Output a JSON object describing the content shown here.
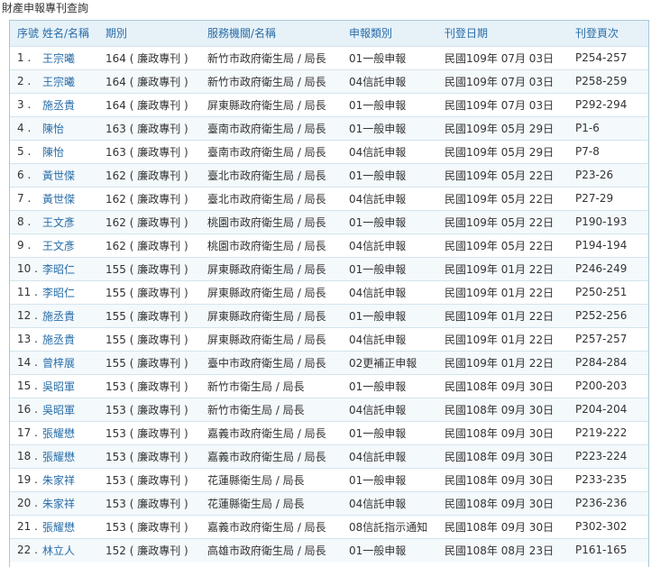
{
  "page": {
    "title": "財產申報專刊查詢"
  },
  "table": {
    "headers": {
      "no": "序號",
      "name": "姓名/名稱",
      "issue": "期別",
      "org": "服務機關/名稱",
      "type": "申報類別",
      "date": "刊登日期",
      "page": "刊登頁次"
    },
    "rows": [
      {
        "no": "1 .",
        "name": "王宗曦",
        "issue": "164 ( 廉政專刊 )",
        "org": "新竹市政府衛生局 / 局長",
        "type": "01一般申報",
        "date": "民國109年 07月 03日",
        "page": "P254-257"
      },
      {
        "no": "2 .",
        "name": "王宗曦",
        "issue": "164 ( 廉政專刊 )",
        "org": "新竹市政府衛生局 / 局長",
        "type": "04信託申報",
        "date": "民國109年 07月 03日",
        "page": "P258-259"
      },
      {
        "no": "3 .",
        "name": "施丞貴",
        "issue": "164 ( 廉政專刊 )",
        "org": "屏東縣政府衛生局 / 局長",
        "type": "01一般申報",
        "date": "民國109年 07月 03日",
        "page": "P292-294"
      },
      {
        "no": "4 .",
        "name": "陳怡",
        "issue": "163 ( 廉政專刊 )",
        "org": "臺南市政府衛生局 / 局長",
        "type": "01一般申報",
        "date": "民國109年 05月 29日",
        "page": "P1-6"
      },
      {
        "no": "5 .",
        "name": "陳怡",
        "issue": "163 ( 廉政專刊 )",
        "org": "臺南市政府衛生局 / 局長",
        "type": "04信託申報",
        "date": "民國109年 05月 29日",
        "page": "P7-8"
      },
      {
        "no": "6 .",
        "name": "黃世傑",
        "issue": "162 ( 廉政專刊 )",
        "org": "臺北市政府衛生局 / 局長",
        "type": "01一般申報",
        "date": "民國109年 05月 22日",
        "page": "P23-26"
      },
      {
        "no": "7 .",
        "name": "黃世傑",
        "issue": "162 ( 廉政專刊 )",
        "org": "臺北市政府衛生局 / 局長",
        "type": "04信託申報",
        "date": "民國109年 05月 22日",
        "page": "P27-29"
      },
      {
        "no": "8 .",
        "name": "王文彥",
        "issue": "162 ( 廉政專刊 )",
        "org": "桃園市政府衛生局 / 局長",
        "type": "01一般申報",
        "date": "民國109年 05月 22日",
        "page": "P190-193"
      },
      {
        "no": "9 .",
        "name": "王文彥",
        "issue": "162 ( 廉政專刊 )",
        "org": "桃園市政府衛生局 / 局長",
        "type": "04信託申報",
        "date": "民國109年 05月 22日",
        "page": "P194-194"
      },
      {
        "no": "10 .",
        "name": "李昭仁",
        "issue": "155 ( 廉政專刊 )",
        "org": "屏東縣政府衛生局 / 局長",
        "type": "01一般申報",
        "date": "民國109年 01月 22日",
        "page": "P246-249"
      },
      {
        "no": "11 .",
        "name": "李昭仁",
        "issue": "155 ( 廉政專刊 )",
        "org": "屏東縣政府衛生局 / 局長",
        "type": "04信託申報",
        "date": "民國109年 01月 22日",
        "page": "P250-251"
      },
      {
        "no": "12 .",
        "name": "施丞貴",
        "issue": "155 ( 廉政專刊 )",
        "org": "屏東縣政府衛生局 / 局長",
        "type": "01一般申報",
        "date": "民國109年 01月 22日",
        "page": "P252-256"
      },
      {
        "no": "13 .",
        "name": "施丞貴",
        "issue": "155 ( 廉政專刊 )",
        "org": "屏東縣政府衛生局 / 局長",
        "type": "04信託申報",
        "date": "民國109年 01月 22日",
        "page": "P257-257"
      },
      {
        "no": "14 .",
        "name": "曾梓展",
        "issue": "155 ( 廉政專刊 )",
        "org": "臺中市政府衛生局 / 局長",
        "type": "02更補正申報",
        "date": "民國109年 01月 22日",
        "page": "P284-284"
      },
      {
        "no": "15 .",
        "name": "吳昭軍",
        "issue": "153 ( 廉政專刊 )",
        "org": "新竹市衛生局 / 局長",
        "type": "01一般申報",
        "date": "民國108年 09月 30日",
        "page": "P200-203"
      },
      {
        "no": "16 .",
        "name": "吳昭軍",
        "issue": "153 ( 廉政專刊 )",
        "org": "新竹市衛生局 / 局長",
        "type": "04信託申報",
        "date": "民國108年 09月 30日",
        "page": "P204-204"
      },
      {
        "no": "17 .",
        "name": "張耀懋",
        "issue": "153 ( 廉政專刊 )",
        "org": "嘉義市政府衛生局 / 局長",
        "type": "01一般申報",
        "date": "民國108年 09月 30日",
        "page": "P219-222"
      },
      {
        "no": "18 .",
        "name": "張耀懋",
        "issue": "153 ( 廉政專刊 )",
        "org": "嘉義市政府衛生局 / 局長",
        "type": "04信託申報",
        "date": "民國108年 09月 30日",
        "page": "P223-224"
      },
      {
        "no": "19 .",
        "name": "朱家祥",
        "issue": "153 ( 廉政專刊 )",
        "org": "花蓮縣衛生局 / 局長",
        "type": "01一般申報",
        "date": "民國108年 09月 30日",
        "page": "P233-235"
      },
      {
        "no": "20 .",
        "name": "朱家祥",
        "issue": "153 ( 廉政專刊 )",
        "org": "花蓮縣衛生局 / 局長",
        "type": "04信託申報",
        "date": "民國108年 09月 30日",
        "page": "P236-236"
      },
      {
        "no": "21 .",
        "name": "張耀懋",
        "issue": "153 ( 廉政專刊 )",
        "org": "嘉義市政府衛生局 / 局長",
        "type": "08信託指示通知",
        "date": "民國108年 09月 30日",
        "page": "P302-302"
      },
      {
        "no": "22 .",
        "name": "林立人",
        "issue": "152 ( 廉政專刊 )",
        "org": "高雄市政府衛生局 / 局長",
        "type": "01一般申報",
        "date": "民國108年 08月 23日",
        "page": "P161-165"
      }
    ]
  }
}
